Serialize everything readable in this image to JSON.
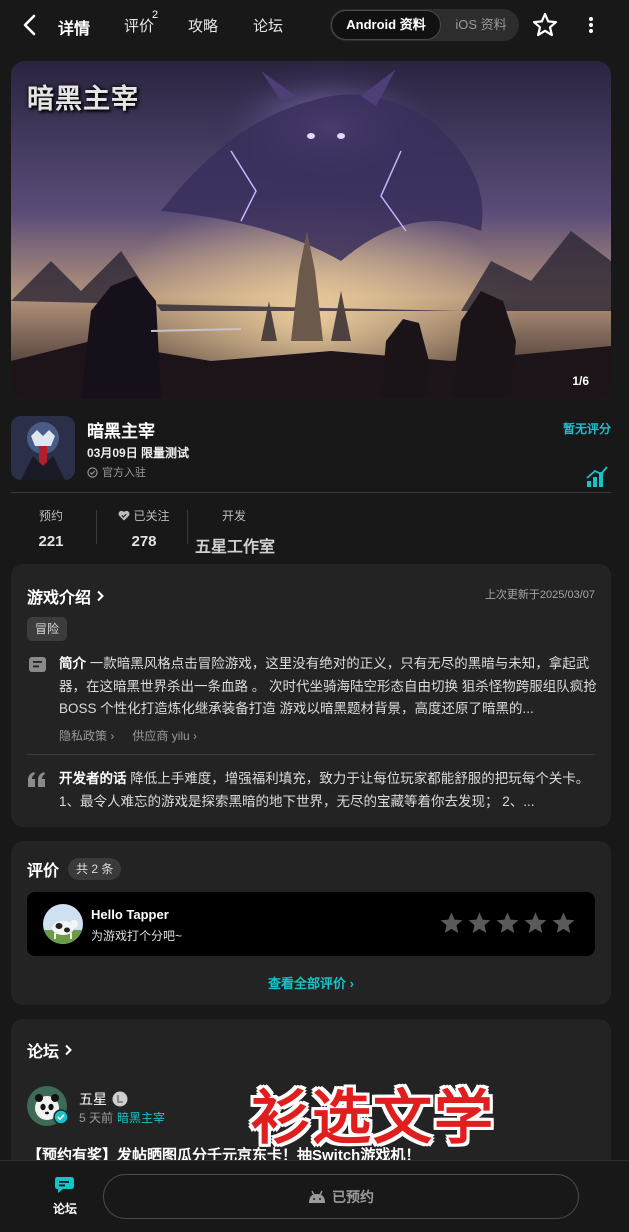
{
  "nav": {
    "tabs": [
      {
        "label": "详情"
      },
      {
        "label": "评价",
        "badge": "2"
      },
      {
        "label": "攻略"
      },
      {
        "label": "论坛"
      }
    ],
    "platforms": {
      "android": "Android 资料",
      "ios": "iOS 资料"
    }
  },
  "banner": {
    "logo_text": "暗黑主宰",
    "counter": "1/6"
  },
  "game": {
    "name": "暗黑主宰",
    "date": "03月09日 限量测试",
    "official": "官方入驻",
    "rating_status": "暂无评分"
  },
  "stats": {
    "reserve_label": "预约",
    "reserve_value": "221",
    "follow_label": "已关注",
    "follow_value": "278",
    "dev_label": "开发",
    "dev_value": "五星工作室"
  },
  "intro": {
    "title": "游戏介绍",
    "update_time": "上次更新于2025/03/07",
    "tag": "冒险",
    "summary_label": "简介",
    "summary": " 一款暗黑风格点击冒险游戏，这里没有绝对的正义，只有无尽的黑暗与未知，拿起武器，在这暗黑世界杀出一条血路 。 次时代坐骑海陆空形态自由切换 狙杀怪物跨服组队疯抢BOSS 个性化打造炼化继承装备打造 游戏以暗黑题材背景，高度还原了暗黑的...",
    "privacy": "隐私政策",
    "provider": "供应商 yilu",
    "dev_note_label": "开发者的话",
    "dev_note": " 降低上手难度，增强福利填充，致力于让每位玩家都能舒服的把玩每个关卡。 1、最令人难忘的游戏是探索黑暗的地下世界，无尽的宝藏等着你去发现； 2、..."
  },
  "reviews": {
    "title": "评价",
    "count": "共 2 条",
    "prompt_name": "Hello Tapper",
    "prompt_sub": "为游戏打个分吧~",
    "view_all": "查看全部评价"
  },
  "forum": {
    "title": "论坛",
    "author": "五星",
    "time": "5 天前",
    "game": "暗黑主宰",
    "post_title": "【预约有奖】发帖晒图瓜分千元京东卡！抽Switch游戏机！"
  },
  "watermark": "衫选文学",
  "bottom": {
    "forum_label": "论坛",
    "reserve_label": "已预约"
  },
  "colors": {
    "accent": "#17c2c9",
    "background": "#181818",
    "card": "#232323"
  }
}
